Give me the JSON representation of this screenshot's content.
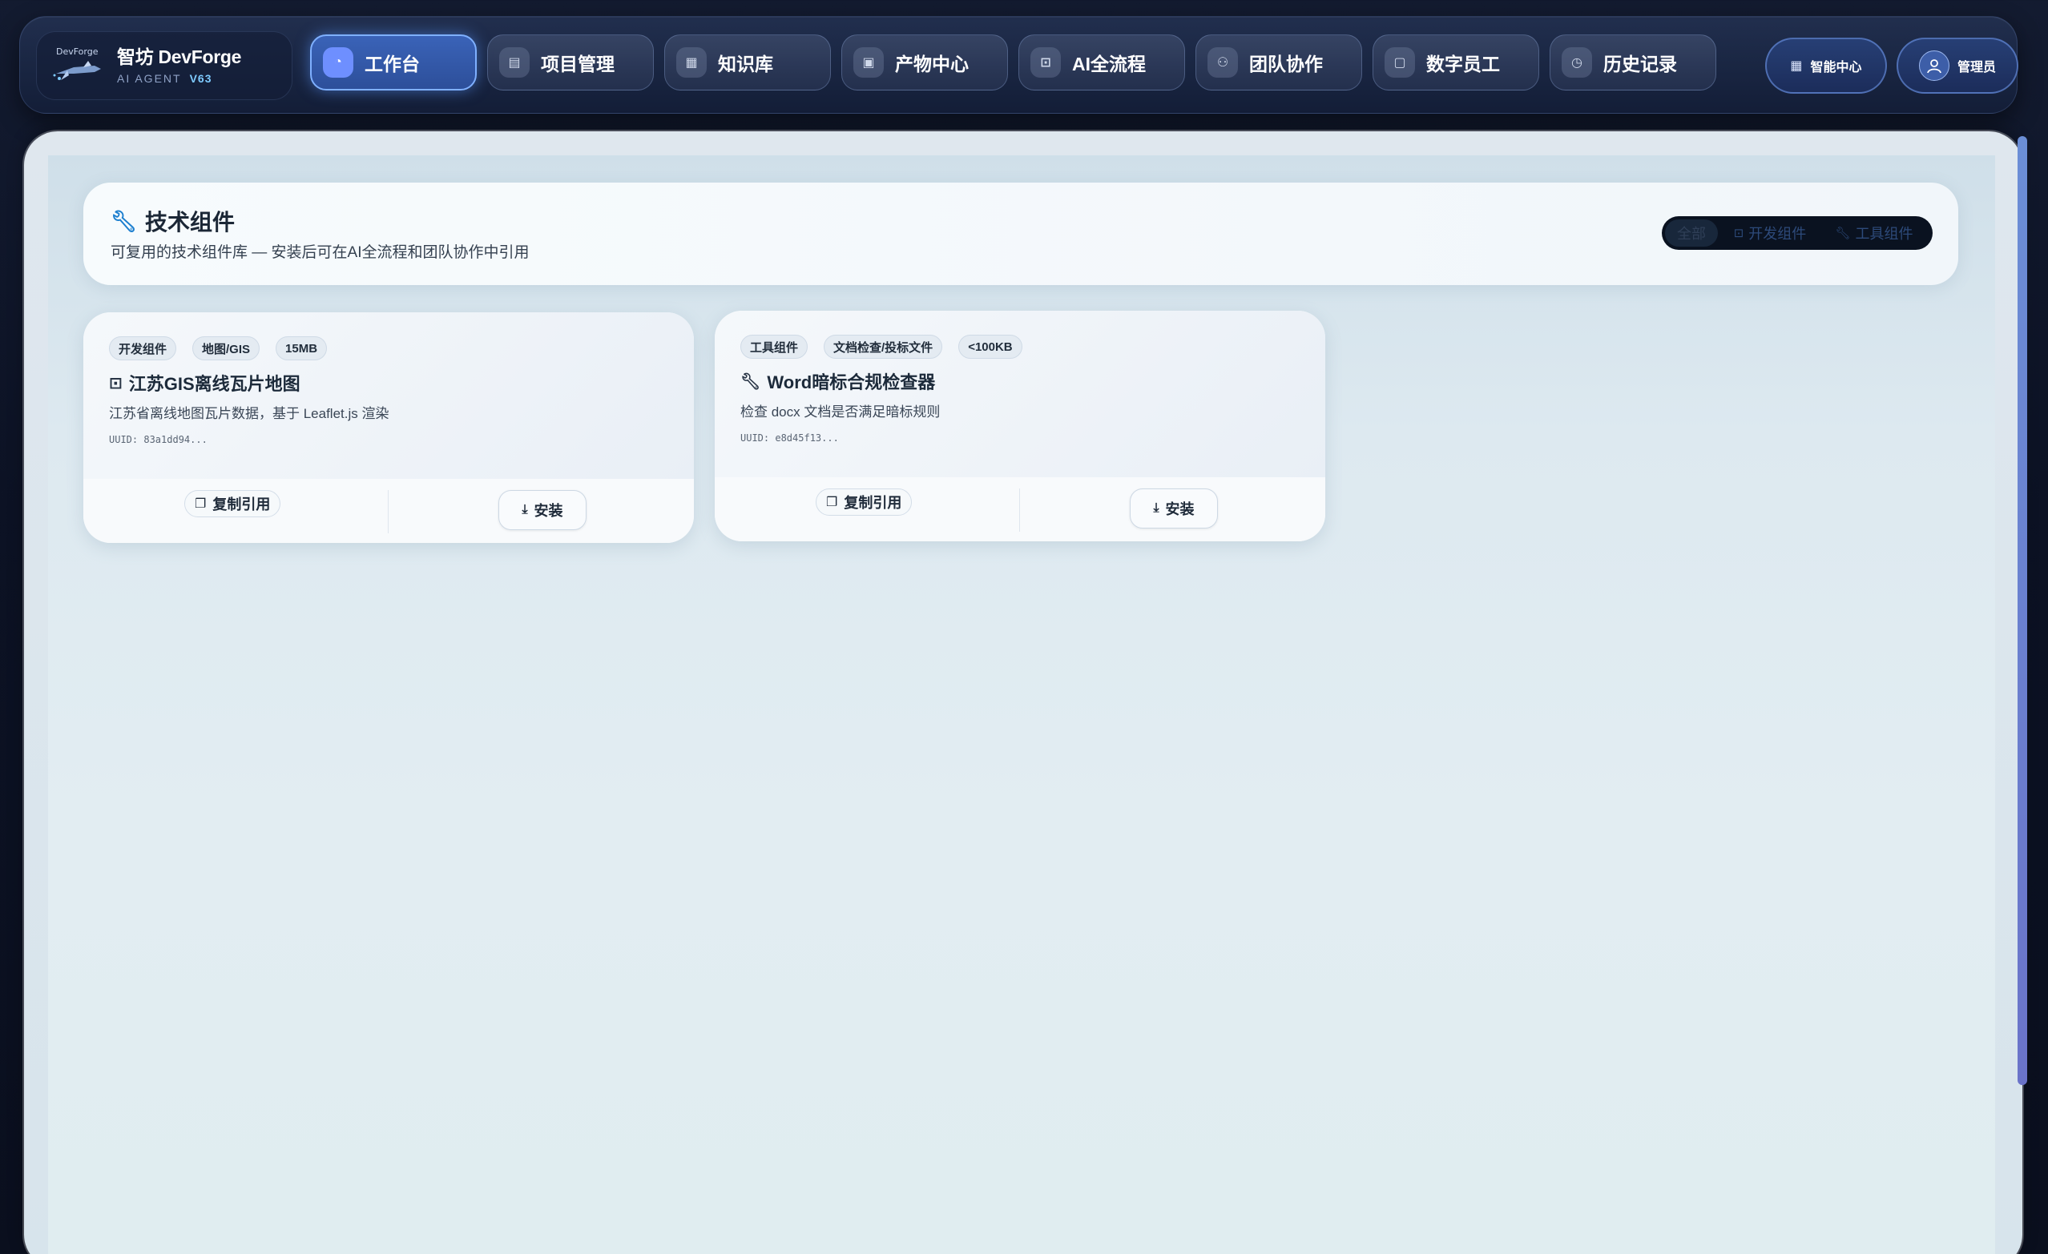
{
  "brand": {
    "logo_text": "DevForge",
    "title": "智坊 DevForge",
    "subtitle": "AI AGENT",
    "version": "V63"
  },
  "nav": {
    "items": [
      {
        "label": "工作台",
        "icon": "dashboard-icon",
        "active": true
      },
      {
        "label": "项目管理",
        "icon": "kanban-icon"
      },
      {
        "label": "知识库",
        "icon": "book-icon"
      },
      {
        "label": "产物中心",
        "icon": "document-icon"
      },
      {
        "label": "AI全流程",
        "icon": "terminal-icon"
      },
      {
        "label": "团队协作",
        "icon": "team-icon"
      },
      {
        "label": "数字员工",
        "icon": "bot-icon"
      },
      {
        "label": "历史记录",
        "icon": "clock-icon"
      }
    ],
    "smart_center": "智能中心",
    "admin": "管理员"
  },
  "page": {
    "title": "技术组件",
    "subtitle": "可复用的技术组件库 — 安装后可在AI全流程和团队协作中引用",
    "filters": {
      "all": "全部",
      "dev": "开发组件",
      "tool": "工具组件"
    }
  },
  "components": [
    {
      "tags": [
        "开发组件",
        "地图/GIS",
        "15MB"
      ],
      "title": "江苏GIS离线瓦片地图",
      "icon": "terminal-icon",
      "desc": "江苏省离线地图瓦片数据，基于 Leaflet.js 渲染",
      "uuid": "UUID: 83a1dd94...",
      "copy_label": "复制引用",
      "install_label": "安装"
    },
    {
      "tags": [
        "工具组件",
        "文档检查/投标文件",
        "<100KB"
      ],
      "title": "Word暗标合规检查器",
      "icon": "wrench-icon",
      "desc": "检查 docx 文档是否满足暗标规则",
      "uuid": "UUID: e8d45f13...",
      "copy_label": "复制引用",
      "install_label": "安装"
    }
  ],
  "colors": {
    "accent": "#3a63b8",
    "active_border": "#7fb0ff",
    "title_icon": "#1d7fcf"
  }
}
